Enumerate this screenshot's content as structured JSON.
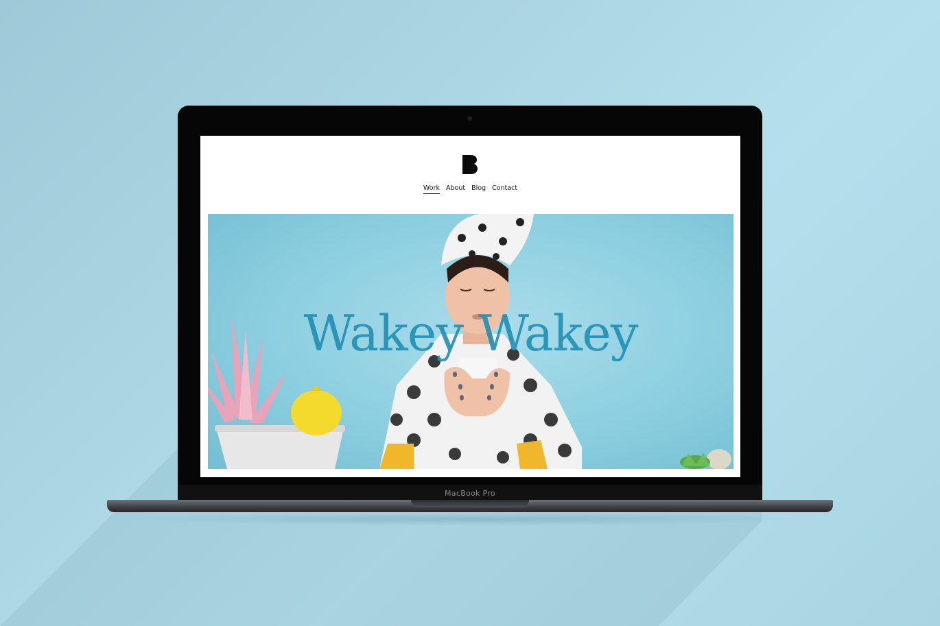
{
  "device": {
    "label": "MacBook Pro"
  },
  "site": {
    "logo_letter": "B",
    "nav": [
      {
        "label": "Work",
        "active": true
      },
      {
        "label": "About",
        "active": false
      },
      {
        "label": "Blog",
        "active": false
      },
      {
        "label": "Contact",
        "active": false
      }
    ],
    "hero": {
      "title": "Wakey Wakey",
      "image": "woman-with-towel-turban-holding-mug"
    }
  },
  "colors": {
    "background": "#a9d4e2",
    "hero_bg": "#8ccfe0",
    "title": "#1f8fb3"
  }
}
